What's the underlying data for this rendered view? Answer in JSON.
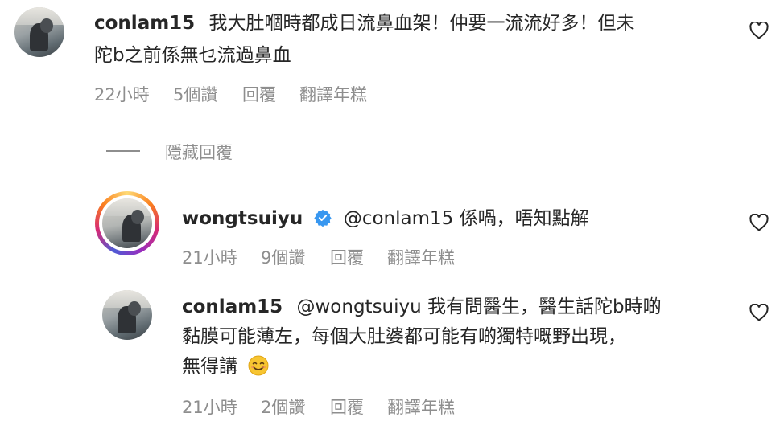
{
  "comments": [
    {
      "username": "conlam15",
      "text_line1": "我大肚嗰時都成日流鼻血架！仲要一流流好多！但未",
      "text_line2": "陀b之前係無乜流過鼻血",
      "time": "22小時",
      "likes": "5個讚",
      "reply": "回覆",
      "translate": "翻譯年糕"
    },
    {
      "username": "wongtsuiyu",
      "text": "@conlam15 係喎，唔知點解",
      "time": "21小時",
      "likes": "9個讚",
      "reply": "回覆",
      "translate": "翻譯年糕"
    },
    {
      "username": "conlam15",
      "text_line1": "@wongtsuiyu 我有問醫生，醫生話陀b時啲",
      "text_line2": "黏膜可能薄左，每個大肚婆都可能有啲獨特嘅野出現，",
      "text_line3": "無得講",
      "time": "21小時",
      "likes": "2個讚",
      "reply": "回覆",
      "translate": "翻譯年糕"
    }
  ],
  "hide_replies": "隱藏回覆",
  "icons": {
    "heart": "heart-outline-icon",
    "verified": "verified-badge-icon",
    "emoji": "smiling-face-emoji"
  },
  "colors": {
    "verified": "#3897f0",
    "meta": "#8e8e8e",
    "text": "#262626"
  }
}
